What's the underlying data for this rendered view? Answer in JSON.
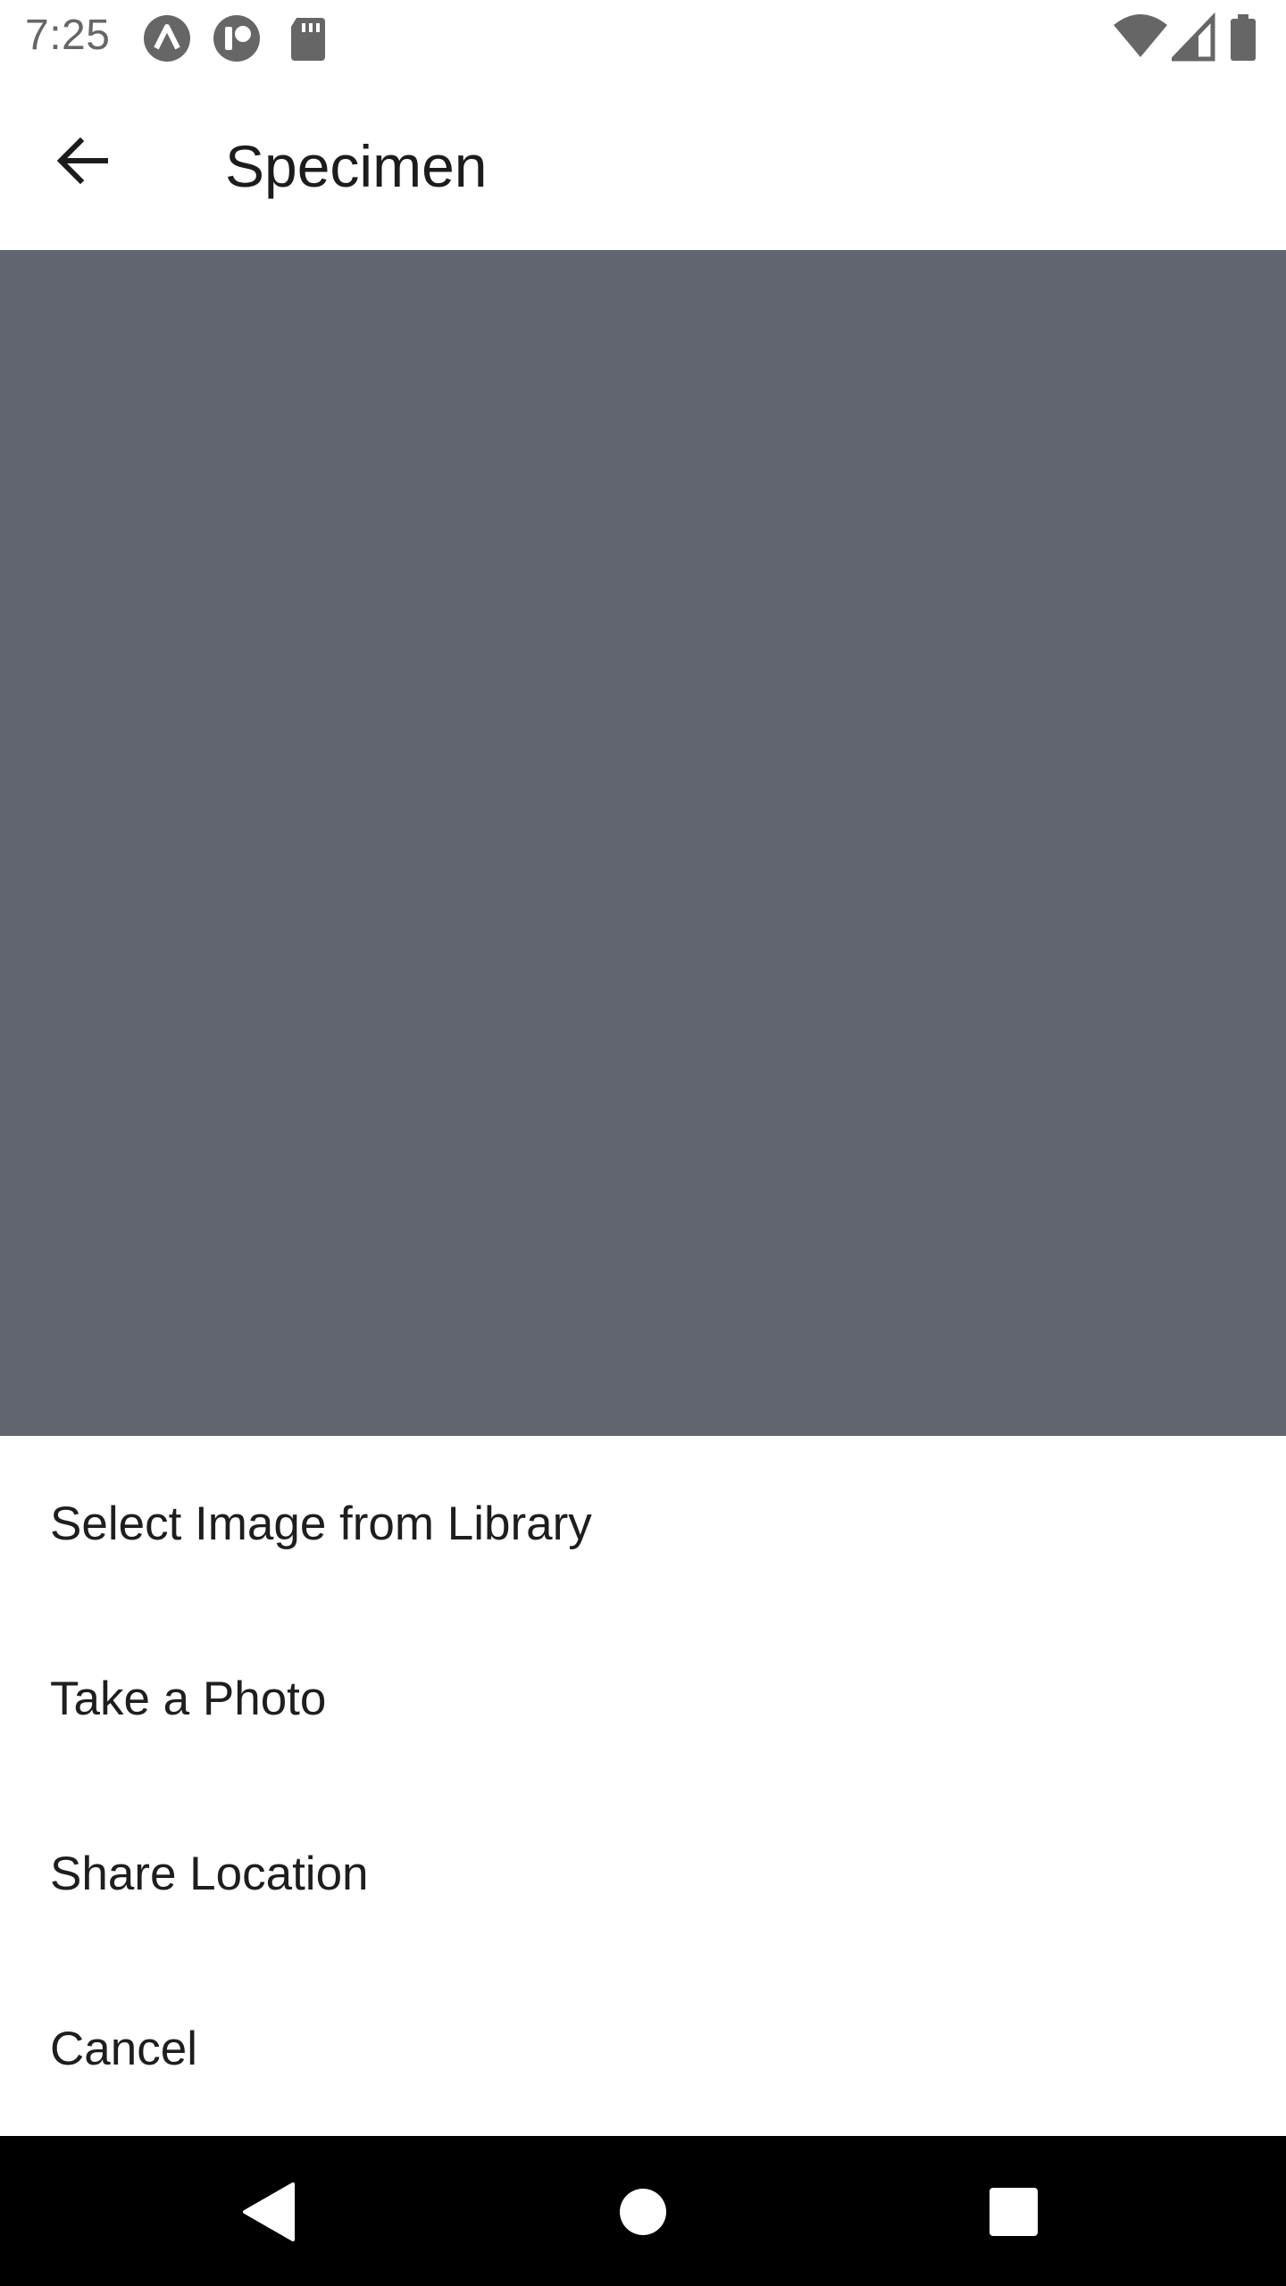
{
  "status_bar": {
    "time": "7:25",
    "notification_icons": [
      "app-a-icon",
      "app-r-icon",
      "sd-card-icon"
    ],
    "system_icons": [
      "wifi-icon",
      "signal-icon",
      "battery-icon"
    ]
  },
  "app_bar": {
    "back_icon": "arrow-back-icon",
    "title": "Specimen"
  },
  "scrim": {
    "color": "#606570"
  },
  "action_sheet": {
    "items": [
      {
        "label": "Select Image from Library"
      },
      {
        "label": "Take a Photo"
      },
      {
        "label": "Share Location"
      },
      {
        "label": "Cancel"
      }
    ]
  },
  "nav_bar": {
    "buttons": [
      "nav-back-icon",
      "nav-home-icon",
      "nav-recents-icon"
    ]
  }
}
